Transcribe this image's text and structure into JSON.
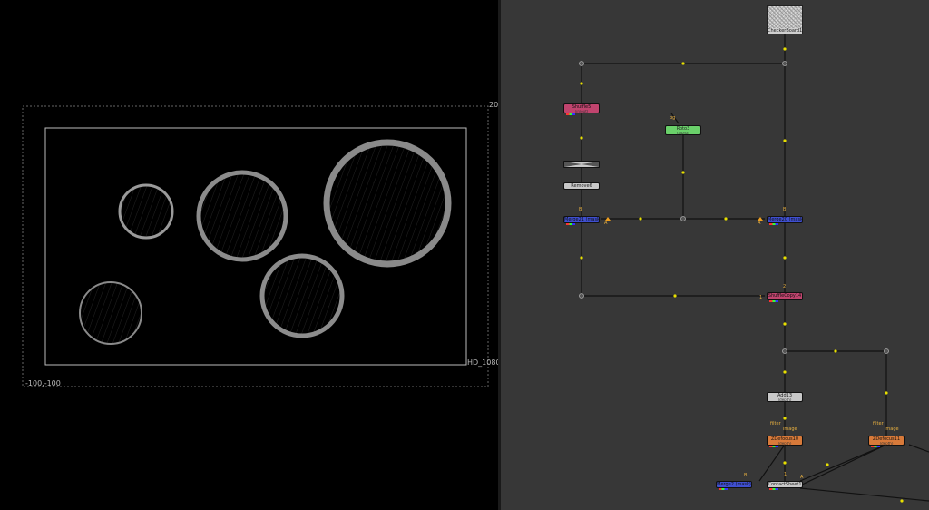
{
  "viewer": {
    "format_label": "HD_1080",
    "coord_bottom_left": "-100,-100",
    "coord_top_right": "20"
  },
  "nodes": {
    "checker": {
      "label": "CheckerBoard1"
    },
    "shuffle": {
      "label": "Shuffle5",
      "sub": "(in/out)"
    },
    "roto": {
      "label": "Roto3",
      "sub": "(alpha)"
    },
    "roto_input": "bg",
    "crop": {
      "label": ""
    },
    "remove": {
      "label": "Remove6"
    },
    "merge_left": {
      "label": "Merge21 (mask)"
    },
    "merge_right": {
      "label": "Merge20 (mask)"
    },
    "copy": {
      "label": "ShuffleCopy14"
    },
    "add": {
      "label": "Add13",
      "sub": "(depth)"
    },
    "zdefocus_left": {
      "label": "ZDefocus10",
      "sub": "(depth)"
    },
    "zdefocus_right": {
      "label": "ZDefocus11",
      "sub": "(depth)"
    },
    "contact": {
      "label": "ContactSheet1"
    },
    "merge_bottom": {
      "label": "Merge2 (mask)"
    }
  },
  "pipe_labels": {
    "b_top": "B",
    "a_left": "A",
    "a_right": "A",
    "b_right": "B",
    "in_2": "2",
    "in_1": "1",
    "filter_left": "filter",
    "image_left": "image",
    "filter_right": "filter",
    "image_right": "image",
    "b_bottom": "B",
    "a_bottom": "A",
    "one_bottom": "1"
  },
  "colors": {
    "graph_bg": "#373737",
    "pipe": "#111111",
    "dot": "#e8e000",
    "pink": "#c0446e",
    "green": "#6ad06a",
    "blue": "#3f4fd0",
    "orange": "#d87a3a",
    "grey": "#c8c8c8"
  }
}
